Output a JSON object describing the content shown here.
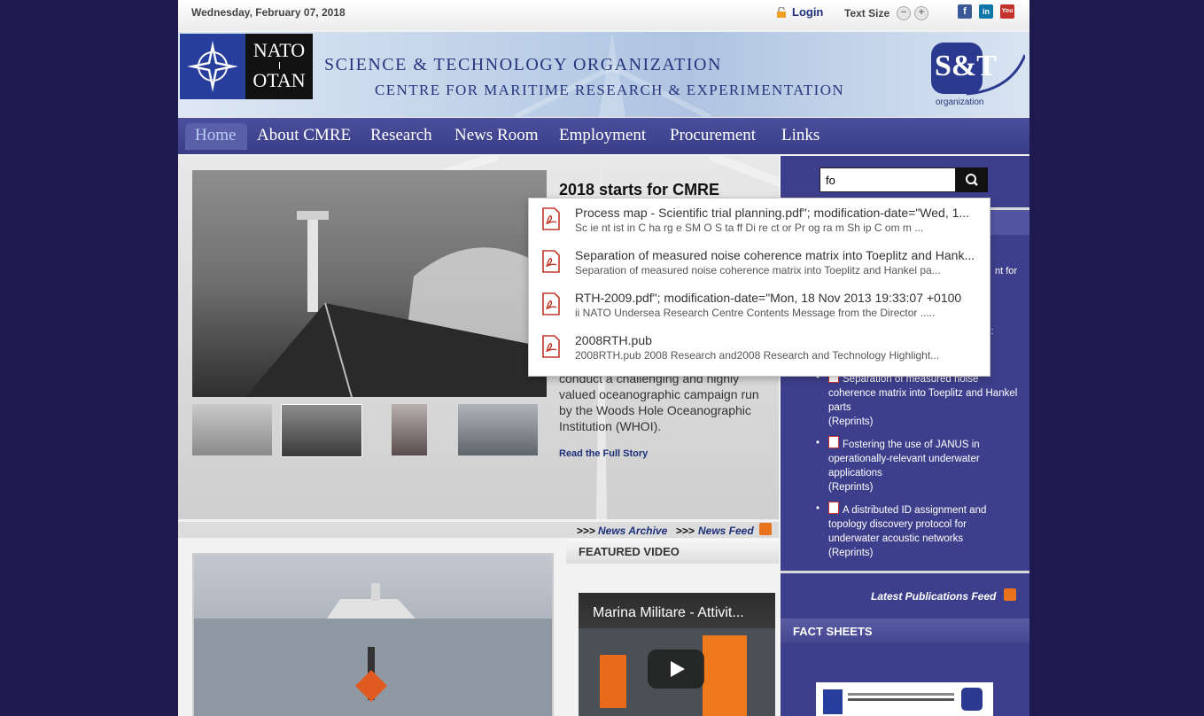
{
  "topbar": {
    "date": "Wednesday, February 07, 2018",
    "login_label": "Login",
    "text_size_label": "Text Size",
    "decrease_glyph": "−",
    "increase_glyph": "+",
    "social": [
      {
        "name": "facebook-icon",
        "glyph": "f",
        "color": "#3b5998"
      },
      {
        "name": "linkedin-icon",
        "glyph": "in",
        "color": "#0e76a8"
      },
      {
        "name": "youtube-icon",
        "glyph": "You",
        "color": "#c4302b"
      }
    ]
  },
  "banner": {
    "nato_top": "NATO",
    "nato_bottom": "OTAN",
    "title": "SCIENCE & TECHNOLOGY ORGANIZATION",
    "subtitle": "CENTRE FOR MARITIME RESEARCH & EXPERIMENTATION",
    "st_mark": "S&T",
    "st_label": "organization"
  },
  "nav": {
    "items": [
      {
        "label": "Home",
        "active": true
      },
      {
        "label": "About CMRE"
      },
      {
        "label": "Research"
      },
      {
        "label": "News Room"
      },
      {
        "label": "Employment"
      },
      {
        "label": "Procurement"
      },
      {
        "label": "Links"
      }
    ]
  },
  "news": {
    "title": "2018 starts for CMRE",
    "body": "conduct a challenging and highly valued oceanographic campaign run by the Woods Hole Oceanographic Institution (WHOI).",
    "read_more": "Read the Full Story",
    "arrows": ">>>",
    "archive": "News Archive",
    "feed": "News Feed"
  },
  "featured": {
    "header": "FEATURED VIDEO",
    "video_title": "Marina Militare - Attivit..."
  },
  "search": {
    "value": "fo"
  },
  "autocomplete": [
    {
      "title": "Process map - Scientific trial planning.pdf\"; modification-date=\"Wed, 1...",
      "snippet": "Sc ie nt ist  in  C ha rg e SM O  S ta ff Di re ct or   Pr og ra m Sh ip  C om m ..."
    },
    {
      "title": "Separation of measured noise coherence matrix into Toeplitz and Hank...",
      "snippet": "Separation of measured noise coherence matrix into Toeplitz and Hankel pa..."
    },
    {
      "title": "RTH-2009.pdf\"; modification-date=\"Mon, 18 Nov 2013 19:33:07 +0100",
      "snippet": "ii NATO Undersea Research Centre Contents Message from the Director ....."
    },
    {
      "title": "2008RTH.pub",
      "snippet": "2008RTH.pub 2008 Research and2008 Research and Technology Highlight..."
    }
  ],
  "right": {
    "partial_1": "nt for",
    "partial_2": "s:",
    "publications": [
      {
        "title": "Separation of measured noise coherence matrix into Toeplitz and Hankel parts",
        "category": "(Reprints)"
      },
      {
        "title": "Fostering the use of JANUS in operationally-relevant underwater applications",
        "category": "(Reprints)"
      },
      {
        "title": "A distributed ID assignment and topology discovery protocol for underwater acoustic networks",
        "category": "(Reprints)"
      }
    ],
    "latest_feed": "Latest Publications Feed",
    "fact_sheets": "FACT SHEETS"
  }
}
